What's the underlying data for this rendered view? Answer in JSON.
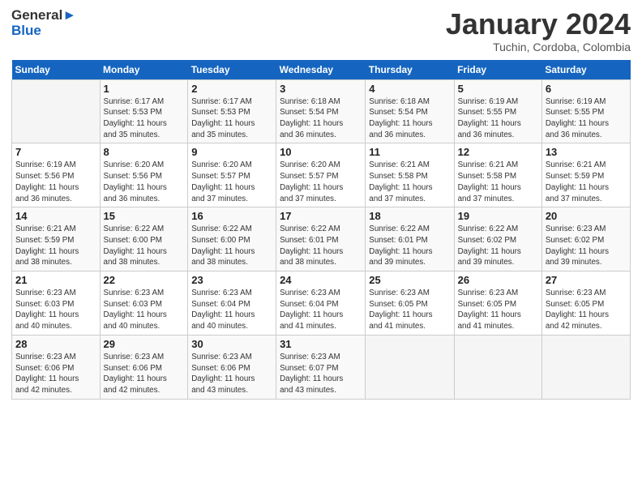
{
  "header": {
    "logo_line1": "General",
    "logo_line2": "Blue",
    "month": "January 2024",
    "location": "Tuchin, Cordoba, Colombia"
  },
  "days_of_week": [
    "Sunday",
    "Monday",
    "Tuesday",
    "Wednesday",
    "Thursday",
    "Friday",
    "Saturday"
  ],
  "weeks": [
    [
      {
        "day": "",
        "info": ""
      },
      {
        "day": "1",
        "info": "Sunrise: 6:17 AM\nSunset: 5:53 PM\nDaylight: 11 hours\nand 35 minutes."
      },
      {
        "day": "2",
        "info": "Sunrise: 6:17 AM\nSunset: 5:53 PM\nDaylight: 11 hours\nand 35 minutes."
      },
      {
        "day": "3",
        "info": "Sunrise: 6:18 AM\nSunset: 5:54 PM\nDaylight: 11 hours\nand 36 minutes."
      },
      {
        "day": "4",
        "info": "Sunrise: 6:18 AM\nSunset: 5:54 PM\nDaylight: 11 hours\nand 36 minutes."
      },
      {
        "day": "5",
        "info": "Sunrise: 6:19 AM\nSunset: 5:55 PM\nDaylight: 11 hours\nand 36 minutes."
      },
      {
        "day": "6",
        "info": "Sunrise: 6:19 AM\nSunset: 5:55 PM\nDaylight: 11 hours\nand 36 minutes."
      }
    ],
    [
      {
        "day": "7",
        "info": "Sunrise: 6:19 AM\nSunset: 5:56 PM\nDaylight: 11 hours\nand 36 minutes."
      },
      {
        "day": "8",
        "info": "Sunrise: 6:20 AM\nSunset: 5:56 PM\nDaylight: 11 hours\nand 36 minutes."
      },
      {
        "day": "9",
        "info": "Sunrise: 6:20 AM\nSunset: 5:57 PM\nDaylight: 11 hours\nand 37 minutes."
      },
      {
        "day": "10",
        "info": "Sunrise: 6:20 AM\nSunset: 5:57 PM\nDaylight: 11 hours\nand 37 minutes."
      },
      {
        "day": "11",
        "info": "Sunrise: 6:21 AM\nSunset: 5:58 PM\nDaylight: 11 hours\nand 37 minutes."
      },
      {
        "day": "12",
        "info": "Sunrise: 6:21 AM\nSunset: 5:58 PM\nDaylight: 11 hours\nand 37 minutes."
      },
      {
        "day": "13",
        "info": "Sunrise: 6:21 AM\nSunset: 5:59 PM\nDaylight: 11 hours\nand 37 minutes."
      }
    ],
    [
      {
        "day": "14",
        "info": "Sunrise: 6:21 AM\nSunset: 5:59 PM\nDaylight: 11 hours\nand 38 minutes."
      },
      {
        "day": "15",
        "info": "Sunrise: 6:22 AM\nSunset: 6:00 PM\nDaylight: 11 hours\nand 38 minutes."
      },
      {
        "day": "16",
        "info": "Sunrise: 6:22 AM\nSunset: 6:00 PM\nDaylight: 11 hours\nand 38 minutes."
      },
      {
        "day": "17",
        "info": "Sunrise: 6:22 AM\nSunset: 6:01 PM\nDaylight: 11 hours\nand 38 minutes."
      },
      {
        "day": "18",
        "info": "Sunrise: 6:22 AM\nSunset: 6:01 PM\nDaylight: 11 hours\nand 39 minutes."
      },
      {
        "day": "19",
        "info": "Sunrise: 6:22 AM\nSunset: 6:02 PM\nDaylight: 11 hours\nand 39 minutes."
      },
      {
        "day": "20",
        "info": "Sunrise: 6:23 AM\nSunset: 6:02 PM\nDaylight: 11 hours\nand 39 minutes."
      }
    ],
    [
      {
        "day": "21",
        "info": "Sunrise: 6:23 AM\nSunset: 6:03 PM\nDaylight: 11 hours\nand 40 minutes."
      },
      {
        "day": "22",
        "info": "Sunrise: 6:23 AM\nSunset: 6:03 PM\nDaylight: 11 hours\nand 40 minutes."
      },
      {
        "day": "23",
        "info": "Sunrise: 6:23 AM\nSunset: 6:04 PM\nDaylight: 11 hours\nand 40 minutes."
      },
      {
        "day": "24",
        "info": "Sunrise: 6:23 AM\nSunset: 6:04 PM\nDaylight: 11 hours\nand 41 minutes."
      },
      {
        "day": "25",
        "info": "Sunrise: 6:23 AM\nSunset: 6:05 PM\nDaylight: 11 hours\nand 41 minutes."
      },
      {
        "day": "26",
        "info": "Sunrise: 6:23 AM\nSunset: 6:05 PM\nDaylight: 11 hours\nand 41 minutes."
      },
      {
        "day": "27",
        "info": "Sunrise: 6:23 AM\nSunset: 6:05 PM\nDaylight: 11 hours\nand 42 minutes."
      }
    ],
    [
      {
        "day": "28",
        "info": "Sunrise: 6:23 AM\nSunset: 6:06 PM\nDaylight: 11 hours\nand 42 minutes."
      },
      {
        "day": "29",
        "info": "Sunrise: 6:23 AM\nSunset: 6:06 PM\nDaylight: 11 hours\nand 42 minutes."
      },
      {
        "day": "30",
        "info": "Sunrise: 6:23 AM\nSunset: 6:06 PM\nDaylight: 11 hours\nand 43 minutes."
      },
      {
        "day": "31",
        "info": "Sunrise: 6:23 AM\nSunset: 6:07 PM\nDaylight: 11 hours\nand 43 minutes."
      },
      {
        "day": "",
        "info": ""
      },
      {
        "day": "",
        "info": ""
      },
      {
        "day": "",
        "info": ""
      }
    ]
  ]
}
